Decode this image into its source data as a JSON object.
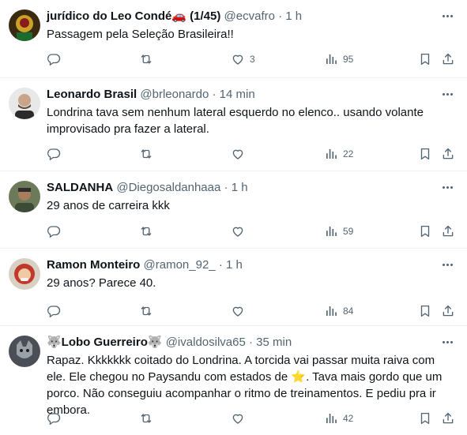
{
  "tweets": [
    {
      "name": "jurídico do Leo Condé🚗 (1/45)",
      "handle": "@ecvafro",
      "dot": "·",
      "time": "1 h",
      "text": "Passagem pela Seleção Brasileira!!",
      "replies": "",
      "retweets": "",
      "likes": "3",
      "views": "95"
    },
    {
      "name": "Leonardo Brasil",
      "handle": "@brleonardo",
      "dot": "·",
      "time": "14 min",
      "text": "Londrina tava sem nenhum lateral esquerdo no elenco.. usando volante improvisado pra fazer a lateral.",
      "replies": "",
      "retweets": "",
      "likes": "",
      "views": "22"
    },
    {
      "name": "SALDANHA",
      "handle": "@Diegosaldanhaaa",
      "dot": "·",
      "time": "1 h",
      "text": "29 anos de carreira kkk",
      "replies": "",
      "retweets": "",
      "likes": "",
      "views": "59"
    },
    {
      "name": "Ramon Monteiro",
      "handle": "@ramon_92_",
      "dot": "·",
      "time": "1 h",
      "text": "29 anos? Parece 40.",
      "replies": "",
      "retweets": "",
      "likes": "",
      "views": "84"
    },
    {
      "name": "🐺Lobo Guerreiro🐺",
      "handle": "@ivaldosilva65",
      "dot": "·",
      "time": "35 min",
      "text_before": "Rapaz. Kkkkkkk coitado do Londrina. A torcida vai passar muita raiva com ele. Ele chegou no Paysandu com estados de ",
      "text_emoji": "⭐",
      "text_after": ". Tava mais gordo que um porco. Não conseguiu acompanhar o ritmo de treinamentos. E pediu pra ir embora.",
      "replies": "",
      "retweets": "",
      "likes": "",
      "views": "42"
    }
  ],
  "colors": {
    "text": "#0f1419",
    "secondary": "#536471",
    "divider": "#eff3f4"
  },
  "icons": [
    "reply-icon",
    "retweet-icon",
    "like-icon",
    "views-icon",
    "bookmark-icon",
    "share-icon",
    "more-icon"
  ]
}
